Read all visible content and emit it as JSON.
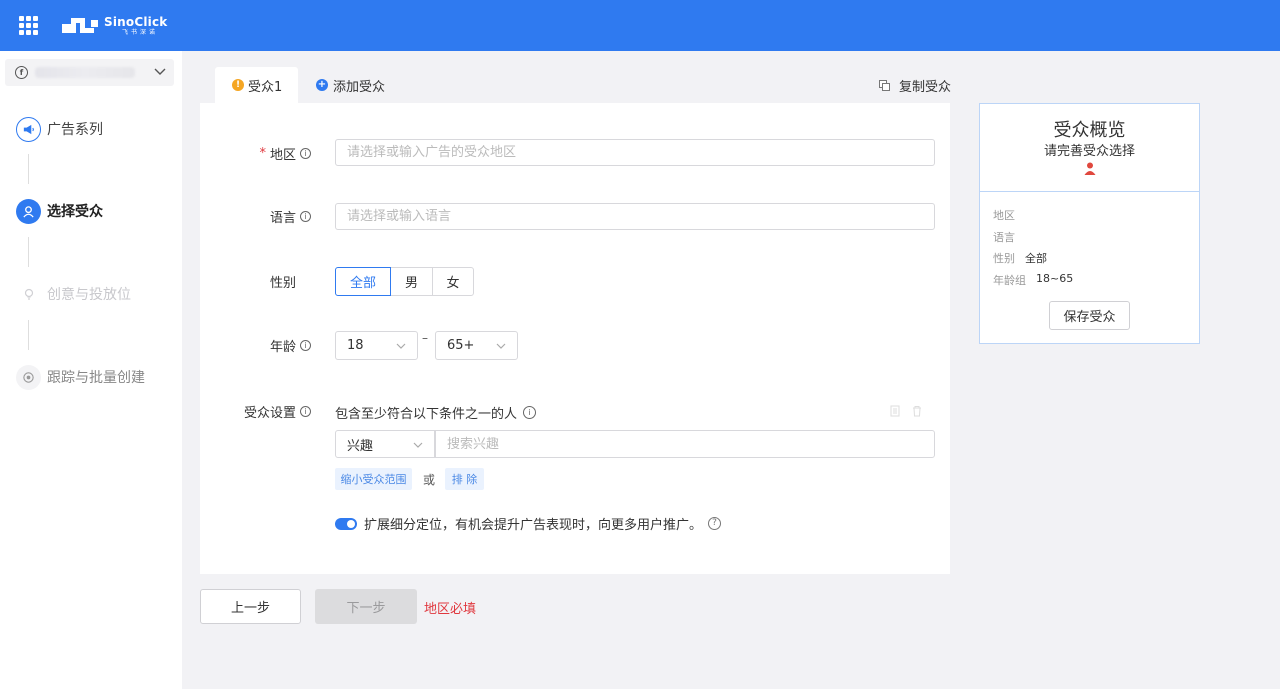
{
  "header": {
    "brand_name": "SinoClick",
    "brand_sub": "飞书深诺",
    "accent_color": "#2f7af0"
  },
  "sidebar": {
    "account_icon": "facebook-icon",
    "steps": [
      {
        "label": "广告系列",
        "state": "done",
        "icon": "megaphone-icon"
      },
      {
        "label": "选择受众",
        "state": "active",
        "icon": "audience-icon"
      },
      {
        "label": "创意与投放位",
        "state": "pending",
        "icon": "lightbulb-icon"
      },
      {
        "label": "跟踪与批量创建",
        "state": "pending",
        "icon": "target-icon"
      }
    ]
  },
  "tabs": {
    "active_label": "受众1",
    "add_label": "添加受众",
    "copy_label": "复制受众"
  },
  "form": {
    "region": {
      "label": "地区",
      "required_mark": "*",
      "placeholder": "请选择或输入广告的受众地区",
      "value": ""
    },
    "language": {
      "label": "语言",
      "placeholder": "请选择或输入语言",
      "value": ""
    },
    "gender": {
      "label": "性别",
      "options": [
        "全部",
        "男",
        "女"
      ],
      "selected": "全部"
    },
    "age": {
      "label": "年龄",
      "min": "18",
      "max": "65+",
      "separator": "–"
    },
    "audience": {
      "label": "受众设置",
      "condition_text": "包含至少符合以下条件之一的人",
      "type_select": "兴趣",
      "search_placeholder": "搜索兴趣",
      "narrow_label": "缩小受众范围",
      "or_label": "或",
      "exclude_label": "排 除"
    },
    "expand": {
      "enabled": true,
      "text": "扩展细分定位，有机会提升广告表现时，向更多用户推广。"
    }
  },
  "footer": {
    "prev_label": "上一步",
    "next_label": "下一步",
    "error_text": "地区必填"
  },
  "overview": {
    "title": "受众概览",
    "subtitle": "请完善受众选择",
    "rows": [
      {
        "key": "地区",
        "value": ""
      },
      {
        "key": "语言",
        "value": ""
      },
      {
        "key": "性别",
        "value": "全部"
      },
      {
        "key": "年龄组",
        "value": "18~65"
      }
    ],
    "save_label": "保存受众"
  }
}
